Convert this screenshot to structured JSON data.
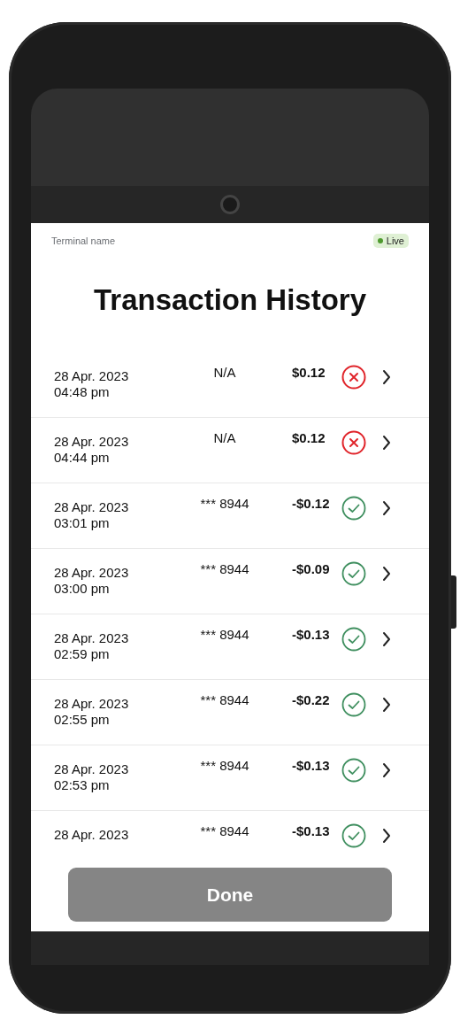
{
  "header": {
    "terminal_name": "Terminal name",
    "badge": "Live"
  },
  "title": "Transaction History",
  "transactions": [
    {
      "date": "28 Apr. 2023",
      "time": "04:48 pm",
      "card": "N/A",
      "amount": "$0.12",
      "success": false
    },
    {
      "date": "28 Apr. 2023",
      "time": "04:44 pm",
      "card": "N/A",
      "amount": "$0.12",
      "success": false
    },
    {
      "date": "28 Apr. 2023",
      "time": "03:01 pm",
      "card": "*** 8944",
      "amount": "-$0.12",
      "success": true
    },
    {
      "date": "28 Apr. 2023",
      "time": "03:00 pm",
      "card": "*** 8944",
      "amount": "-$0.09",
      "success": true
    },
    {
      "date": "28 Apr. 2023",
      "time": "02:59 pm",
      "card": "*** 8944",
      "amount": "-$0.13",
      "success": true
    },
    {
      "date": "28 Apr. 2023",
      "time": "02:55 pm",
      "card": "*** 8944",
      "amount": "-$0.22",
      "success": true
    },
    {
      "date": "28 Apr. 2023",
      "time": "02:53 pm",
      "card": "*** 8944",
      "amount": "-$0.13",
      "success": true
    },
    {
      "date": "28 Apr. 2023",
      "card": "*** 8944",
      "amount": "-$0.13",
      "success": true
    }
  ],
  "done_button": {
    "label": "Done",
    "disabled": true
  }
}
